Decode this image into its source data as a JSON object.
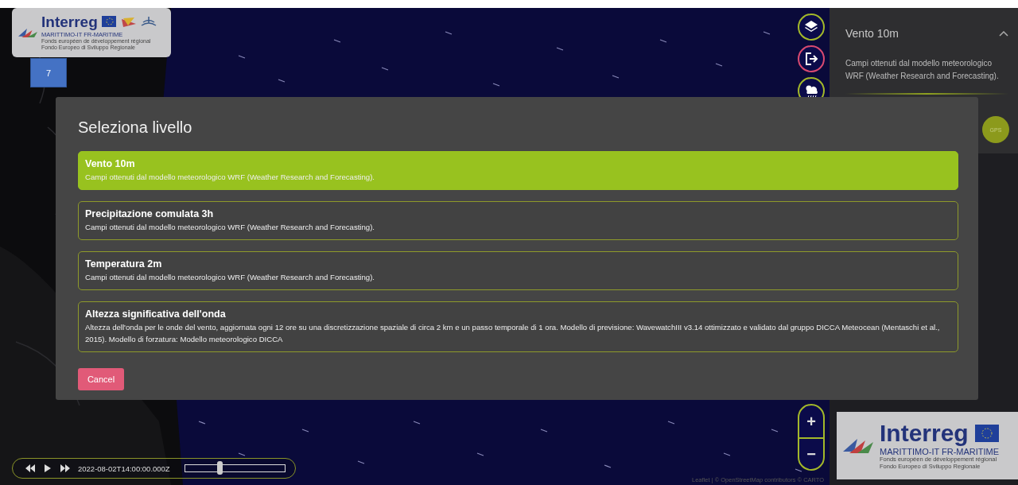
{
  "header_logo": {
    "title": "Interreg",
    "subtitle": "MARITTIMO-IT FR-MARITIME",
    "fund_lines": [
      "Fonds européen de développement régional",
      "Fondo Europeo di Sviluppo Regionale"
    ]
  },
  "badge": "7",
  "map_controls": [
    {
      "kind": "layers"
    },
    {
      "kind": "logout"
    },
    {
      "kind": "weather"
    }
  ],
  "side_panel": {
    "title": "Vento 10m",
    "expanded": true,
    "description": "Campi ottenuti dal modello meteorologico WRF (Weather Research and Forecasting).",
    "gps_label": "GPS"
  },
  "dialog": {
    "title": "Seleziona livello",
    "levels": [
      {
        "name": "Vento 10m",
        "description": "Campi ottenuti dal modello meteorologico WRF (Weather Research and Forecasting).",
        "selected": true
      },
      {
        "name": "Precipitazione comulata 3h",
        "description": "Campi ottenuti dal modello meteorologico WRF (Weather Research and Forecasting).",
        "selected": false
      },
      {
        "name": "Temperatura 2m",
        "description": "Campi ottenuti dal modello meteorologico WRF (Weather Research and Forecasting).",
        "selected": false
      },
      {
        "name": "Altezza significativa dell'onda",
        "description": "Altezza dell'onda per le onde del vento, aggiornata ogni 12 ore su una discretizzazione spaziale di circa 2 km e un passo temporale di 1 ora. Modello di previsione: WavewatchIII v3.14 ottimizzato e validato dal gruppo DICCA Meteocean (Mentaschi et al., 2015). Modello di forzatura: Modello meteorologico DICCA",
        "selected": false
      }
    ],
    "cancel": "Cancel"
  },
  "timeline": {
    "timestamp": "2022-08-02T14:00:00.000Z",
    "level": 0.35
  },
  "zoom": {
    "zoom_in": "+",
    "zoom_out": "−"
  },
  "footer_logo": {
    "title": "Interreg",
    "subtitle": "MARITTIMO-IT FR-MARITIME",
    "fund_lines": [
      "Fonds européen de développement régional",
      "Fondo Europeo di Sviluppo Regionale"
    ]
  },
  "attribution": "Leaflet | © OpenStreetMap contributors © CARTO"
}
